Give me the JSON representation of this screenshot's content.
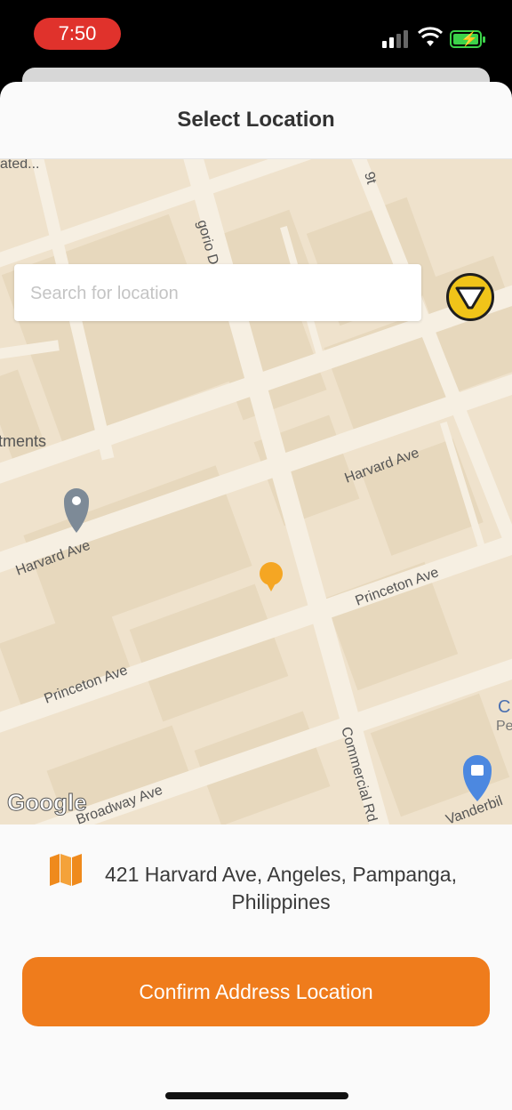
{
  "status_bar": {
    "time": "7:50"
  },
  "header": {
    "title": "Select Location"
  },
  "search": {
    "placeholder": "Search for location"
  },
  "map": {
    "labels": {
      "top_left": "ated...",
      "gregorio": "gorio Dr",
      "top_right": "9t",
      "apartments": "tments",
      "harvard_right": "Harvard Ave",
      "harvard_left": "Harvard Ave",
      "princeton_right": "Princeton Ave",
      "princeton_left": "Princeton Ave",
      "commercial": "Commercial Rd",
      "broadway": "Broadway Ave",
      "vanderbilt": "Vanderbil",
      "shop_c": "C",
      "shop_pe": "Pe",
      "google": "Google"
    },
    "colors": {
      "land": "#efe2cc",
      "road": "#f6efe2",
      "block": "#e7d8bd",
      "pin": "#f5a623"
    }
  },
  "address": {
    "text": "421 Harvard Ave, Angeles, Pampanga, Philippines"
  },
  "confirm_button": {
    "label": "Confirm Address Location"
  },
  "colors": {
    "accent": "#ef7c1c",
    "filter_yellow": "#f0c419"
  }
}
